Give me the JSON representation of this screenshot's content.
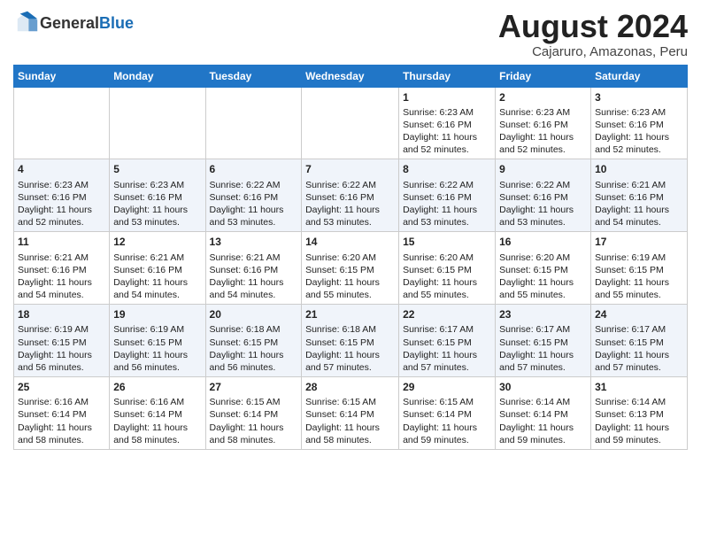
{
  "header": {
    "logo_general": "General",
    "logo_blue": "Blue",
    "title": "August 2024",
    "subtitle": "Cajaruro, Amazonas, Peru"
  },
  "days_of_week": [
    "Sunday",
    "Monday",
    "Tuesday",
    "Wednesday",
    "Thursday",
    "Friday",
    "Saturday"
  ],
  "weeks": [
    [
      {
        "day": "",
        "data": ""
      },
      {
        "day": "",
        "data": ""
      },
      {
        "day": "",
        "data": ""
      },
      {
        "day": "",
        "data": ""
      },
      {
        "day": "1",
        "data": "Sunrise: 6:23 AM\nSunset: 6:16 PM\nDaylight: 11 hours and 52 minutes."
      },
      {
        "day": "2",
        "data": "Sunrise: 6:23 AM\nSunset: 6:16 PM\nDaylight: 11 hours and 52 minutes."
      },
      {
        "day": "3",
        "data": "Sunrise: 6:23 AM\nSunset: 6:16 PM\nDaylight: 11 hours and 52 minutes."
      }
    ],
    [
      {
        "day": "4",
        "data": "Sunrise: 6:23 AM\nSunset: 6:16 PM\nDaylight: 11 hours and 52 minutes."
      },
      {
        "day": "5",
        "data": "Sunrise: 6:23 AM\nSunset: 6:16 PM\nDaylight: 11 hours and 53 minutes."
      },
      {
        "day": "6",
        "data": "Sunrise: 6:22 AM\nSunset: 6:16 PM\nDaylight: 11 hours and 53 minutes."
      },
      {
        "day": "7",
        "data": "Sunrise: 6:22 AM\nSunset: 6:16 PM\nDaylight: 11 hours and 53 minutes."
      },
      {
        "day": "8",
        "data": "Sunrise: 6:22 AM\nSunset: 6:16 PM\nDaylight: 11 hours and 53 minutes."
      },
      {
        "day": "9",
        "data": "Sunrise: 6:22 AM\nSunset: 6:16 PM\nDaylight: 11 hours and 53 minutes."
      },
      {
        "day": "10",
        "data": "Sunrise: 6:21 AM\nSunset: 6:16 PM\nDaylight: 11 hours and 54 minutes."
      }
    ],
    [
      {
        "day": "11",
        "data": "Sunrise: 6:21 AM\nSunset: 6:16 PM\nDaylight: 11 hours and 54 minutes."
      },
      {
        "day": "12",
        "data": "Sunrise: 6:21 AM\nSunset: 6:16 PM\nDaylight: 11 hours and 54 minutes."
      },
      {
        "day": "13",
        "data": "Sunrise: 6:21 AM\nSunset: 6:16 PM\nDaylight: 11 hours and 54 minutes."
      },
      {
        "day": "14",
        "data": "Sunrise: 6:20 AM\nSunset: 6:15 PM\nDaylight: 11 hours and 55 minutes."
      },
      {
        "day": "15",
        "data": "Sunrise: 6:20 AM\nSunset: 6:15 PM\nDaylight: 11 hours and 55 minutes."
      },
      {
        "day": "16",
        "data": "Sunrise: 6:20 AM\nSunset: 6:15 PM\nDaylight: 11 hours and 55 minutes."
      },
      {
        "day": "17",
        "data": "Sunrise: 6:19 AM\nSunset: 6:15 PM\nDaylight: 11 hours and 55 minutes."
      }
    ],
    [
      {
        "day": "18",
        "data": "Sunrise: 6:19 AM\nSunset: 6:15 PM\nDaylight: 11 hours and 56 minutes."
      },
      {
        "day": "19",
        "data": "Sunrise: 6:19 AM\nSunset: 6:15 PM\nDaylight: 11 hours and 56 minutes."
      },
      {
        "day": "20",
        "data": "Sunrise: 6:18 AM\nSunset: 6:15 PM\nDaylight: 11 hours and 56 minutes."
      },
      {
        "day": "21",
        "data": "Sunrise: 6:18 AM\nSunset: 6:15 PM\nDaylight: 11 hours and 57 minutes."
      },
      {
        "day": "22",
        "data": "Sunrise: 6:17 AM\nSunset: 6:15 PM\nDaylight: 11 hours and 57 minutes."
      },
      {
        "day": "23",
        "data": "Sunrise: 6:17 AM\nSunset: 6:15 PM\nDaylight: 11 hours and 57 minutes."
      },
      {
        "day": "24",
        "data": "Sunrise: 6:17 AM\nSunset: 6:15 PM\nDaylight: 11 hours and 57 minutes."
      }
    ],
    [
      {
        "day": "25",
        "data": "Sunrise: 6:16 AM\nSunset: 6:14 PM\nDaylight: 11 hours and 58 minutes."
      },
      {
        "day": "26",
        "data": "Sunrise: 6:16 AM\nSunset: 6:14 PM\nDaylight: 11 hours and 58 minutes."
      },
      {
        "day": "27",
        "data": "Sunrise: 6:15 AM\nSunset: 6:14 PM\nDaylight: 11 hours and 58 minutes."
      },
      {
        "day": "28",
        "data": "Sunrise: 6:15 AM\nSunset: 6:14 PM\nDaylight: 11 hours and 58 minutes."
      },
      {
        "day": "29",
        "data": "Sunrise: 6:15 AM\nSunset: 6:14 PM\nDaylight: 11 hours and 59 minutes."
      },
      {
        "day": "30",
        "data": "Sunrise: 6:14 AM\nSunset: 6:14 PM\nDaylight: 11 hours and 59 minutes."
      },
      {
        "day": "31",
        "data": "Sunrise: 6:14 AM\nSunset: 6:13 PM\nDaylight: 11 hours and 59 minutes."
      }
    ]
  ]
}
